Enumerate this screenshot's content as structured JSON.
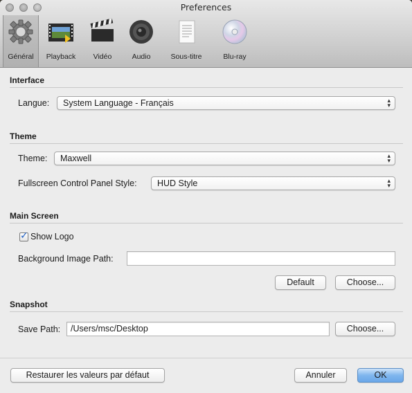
{
  "window": {
    "title": "Preferences"
  },
  "tabs": [
    {
      "label": "Général",
      "icon": "gear-icon",
      "active": true
    },
    {
      "label": "Playback",
      "icon": "film-strip-icon"
    },
    {
      "label": "Vidéo",
      "icon": "clapperboard-icon"
    },
    {
      "label": "Audio",
      "icon": "speaker-icon"
    },
    {
      "label": "Sous-titre",
      "icon": "document-icon"
    },
    {
      "label": "Blu-ray",
      "icon": "disc-icon"
    }
  ],
  "interface": {
    "title": "Interface",
    "langue_label": "Langue:",
    "langue_value": "System Language - Français"
  },
  "theme": {
    "title": "Theme",
    "theme_label": "Theme:",
    "theme_value": "Maxwell",
    "fullscreen_label": "Fullscreen Control Panel Style:",
    "fullscreen_value": "HUD Style"
  },
  "main_screen": {
    "title": "Main Screen",
    "show_logo_label": "Show Logo",
    "show_logo_checked": true,
    "bg_path_label": "Background Image Path:",
    "bg_path_value": "",
    "default_button": "Default",
    "choose_button": "Choose..."
  },
  "snapshot": {
    "title": "Snapshot",
    "save_path_label": "Save Path:",
    "save_path_value": "/Users/msc/Desktop",
    "choose_button": "Choose..."
  },
  "footer": {
    "restore_button": "Restaurer les valeurs par défaut",
    "cancel_button": "Annuler",
    "ok_button": "OK"
  },
  "colors": {
    "accent": "#6aa7e8",
    "window_bg": "#ececec"
  }
}
